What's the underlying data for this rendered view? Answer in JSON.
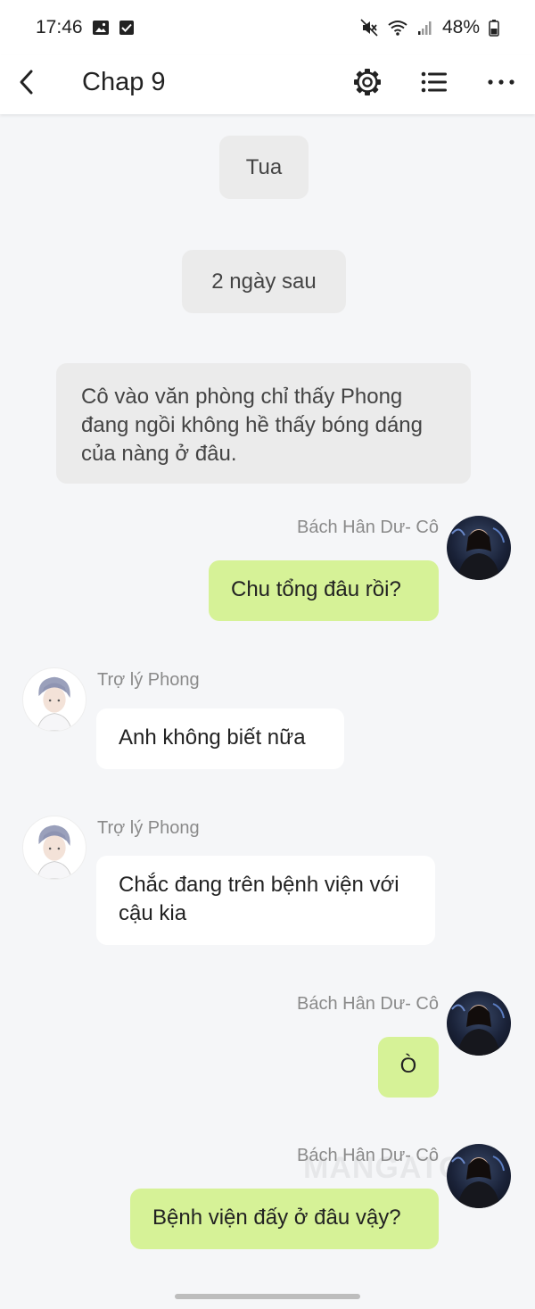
{
  "status_bar": {
    "time": "17:46",
    "battery": "48%",
    "icons": [
      "image-icon",
      "checkbox-icon",
      "mute-icon",
      "wifi-icon",
      "signal-icon",
      "battery-icon"
    ]
  },
  "app_bar": {
    "title": "Chap 9",
    "icons": [
      "back-icon",
      "settings-icon",
      "list-icon",
      "more-icon"
    ]
  },
  "system_messages": {
    "m1": "Tua",
    "m2": "2 ngày sau",
    "m3": "Cô vào văn phòng chỉ thấy Phong đang ngồi không hề thấy bóng dáng của nàng ở đâu."
  },
  "messages": [
    {
      "sender": "Bách Hân Dư- Cô",
      "text": "Chu tổng đâu rồi?",
      "side": "right"
    },
    {
      "sender": "Trợ lý Phong",
      "text": "Anh không biết nữa",
      "side": "left"
    },
    {
      "sender": "Trợ lý Phong",
      "text": "Chắc đang trên bệnh viện với cậu kia",
      "side": "left"
    },
    {
      "sender": "Bách Hân Dư- Cô",
      "text": "Ò",
      "side": "right"
    },
    {
      "sender": "Bách Hân Dư- Cô",
      "text": "Bệnh viện đấy ở đâu vậy?",
      "side": "right"
    }
  ],
  "watermark": "MANGATO",
  "colors": {
    "my_bubble": "#d6f297",
    "other_bubble": "#ffffff",
    "system_bubble": "#ebebeb",
    "background": "#f5f6f8"
  }
}
